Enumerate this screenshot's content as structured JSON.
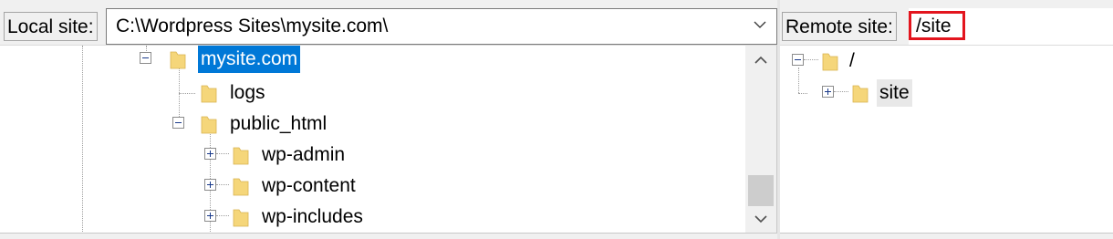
{
  "local": {
    "label": "Local site:",
    "path": "C:\\Wordpress Sites\\mysite.com\\",
    "tree": [
      {
        "label": "mysite.com",
        "state": "expanded",
        "selected": true
      },
      {
        "label": "logs",
        "state": "leaf"
      },
      {
        "label": "public_html",
        "state": "expanded"
      },
      {
        "label": "wp-admin",
        "state": "collapsed"
      },
      {
        "label": "wp-content",
        "state": "collapsed"
      },
      {
        "label": "wp-includes",
        "state": "collapsed"
      }
    ]
  },
  "remote": {
    "label": "Remote site:",
    "path": "/site",
    "tree": [
      {
        "label": "/",
        "state": "expanded"
      },
      {
        "label": "site",
        "state": "collapsed",
        "hovered": true
      }
    ]
  },
  "colors": {
    "selection": "#0078d7",
    "highlight_frame": "#e3151e",
    "folder": "#f5d67a"
  },
  "icons": {
    "folder": "folder-icon",
    "expand": "plus-expander-icon",
    "collapse": "minus-expander-icon",
    "dropdown": "chevron-down-icon",
    "scroll_up": "chevron-up-icon",
    "scroll_down": "chevron-down-icon"
  }
}
